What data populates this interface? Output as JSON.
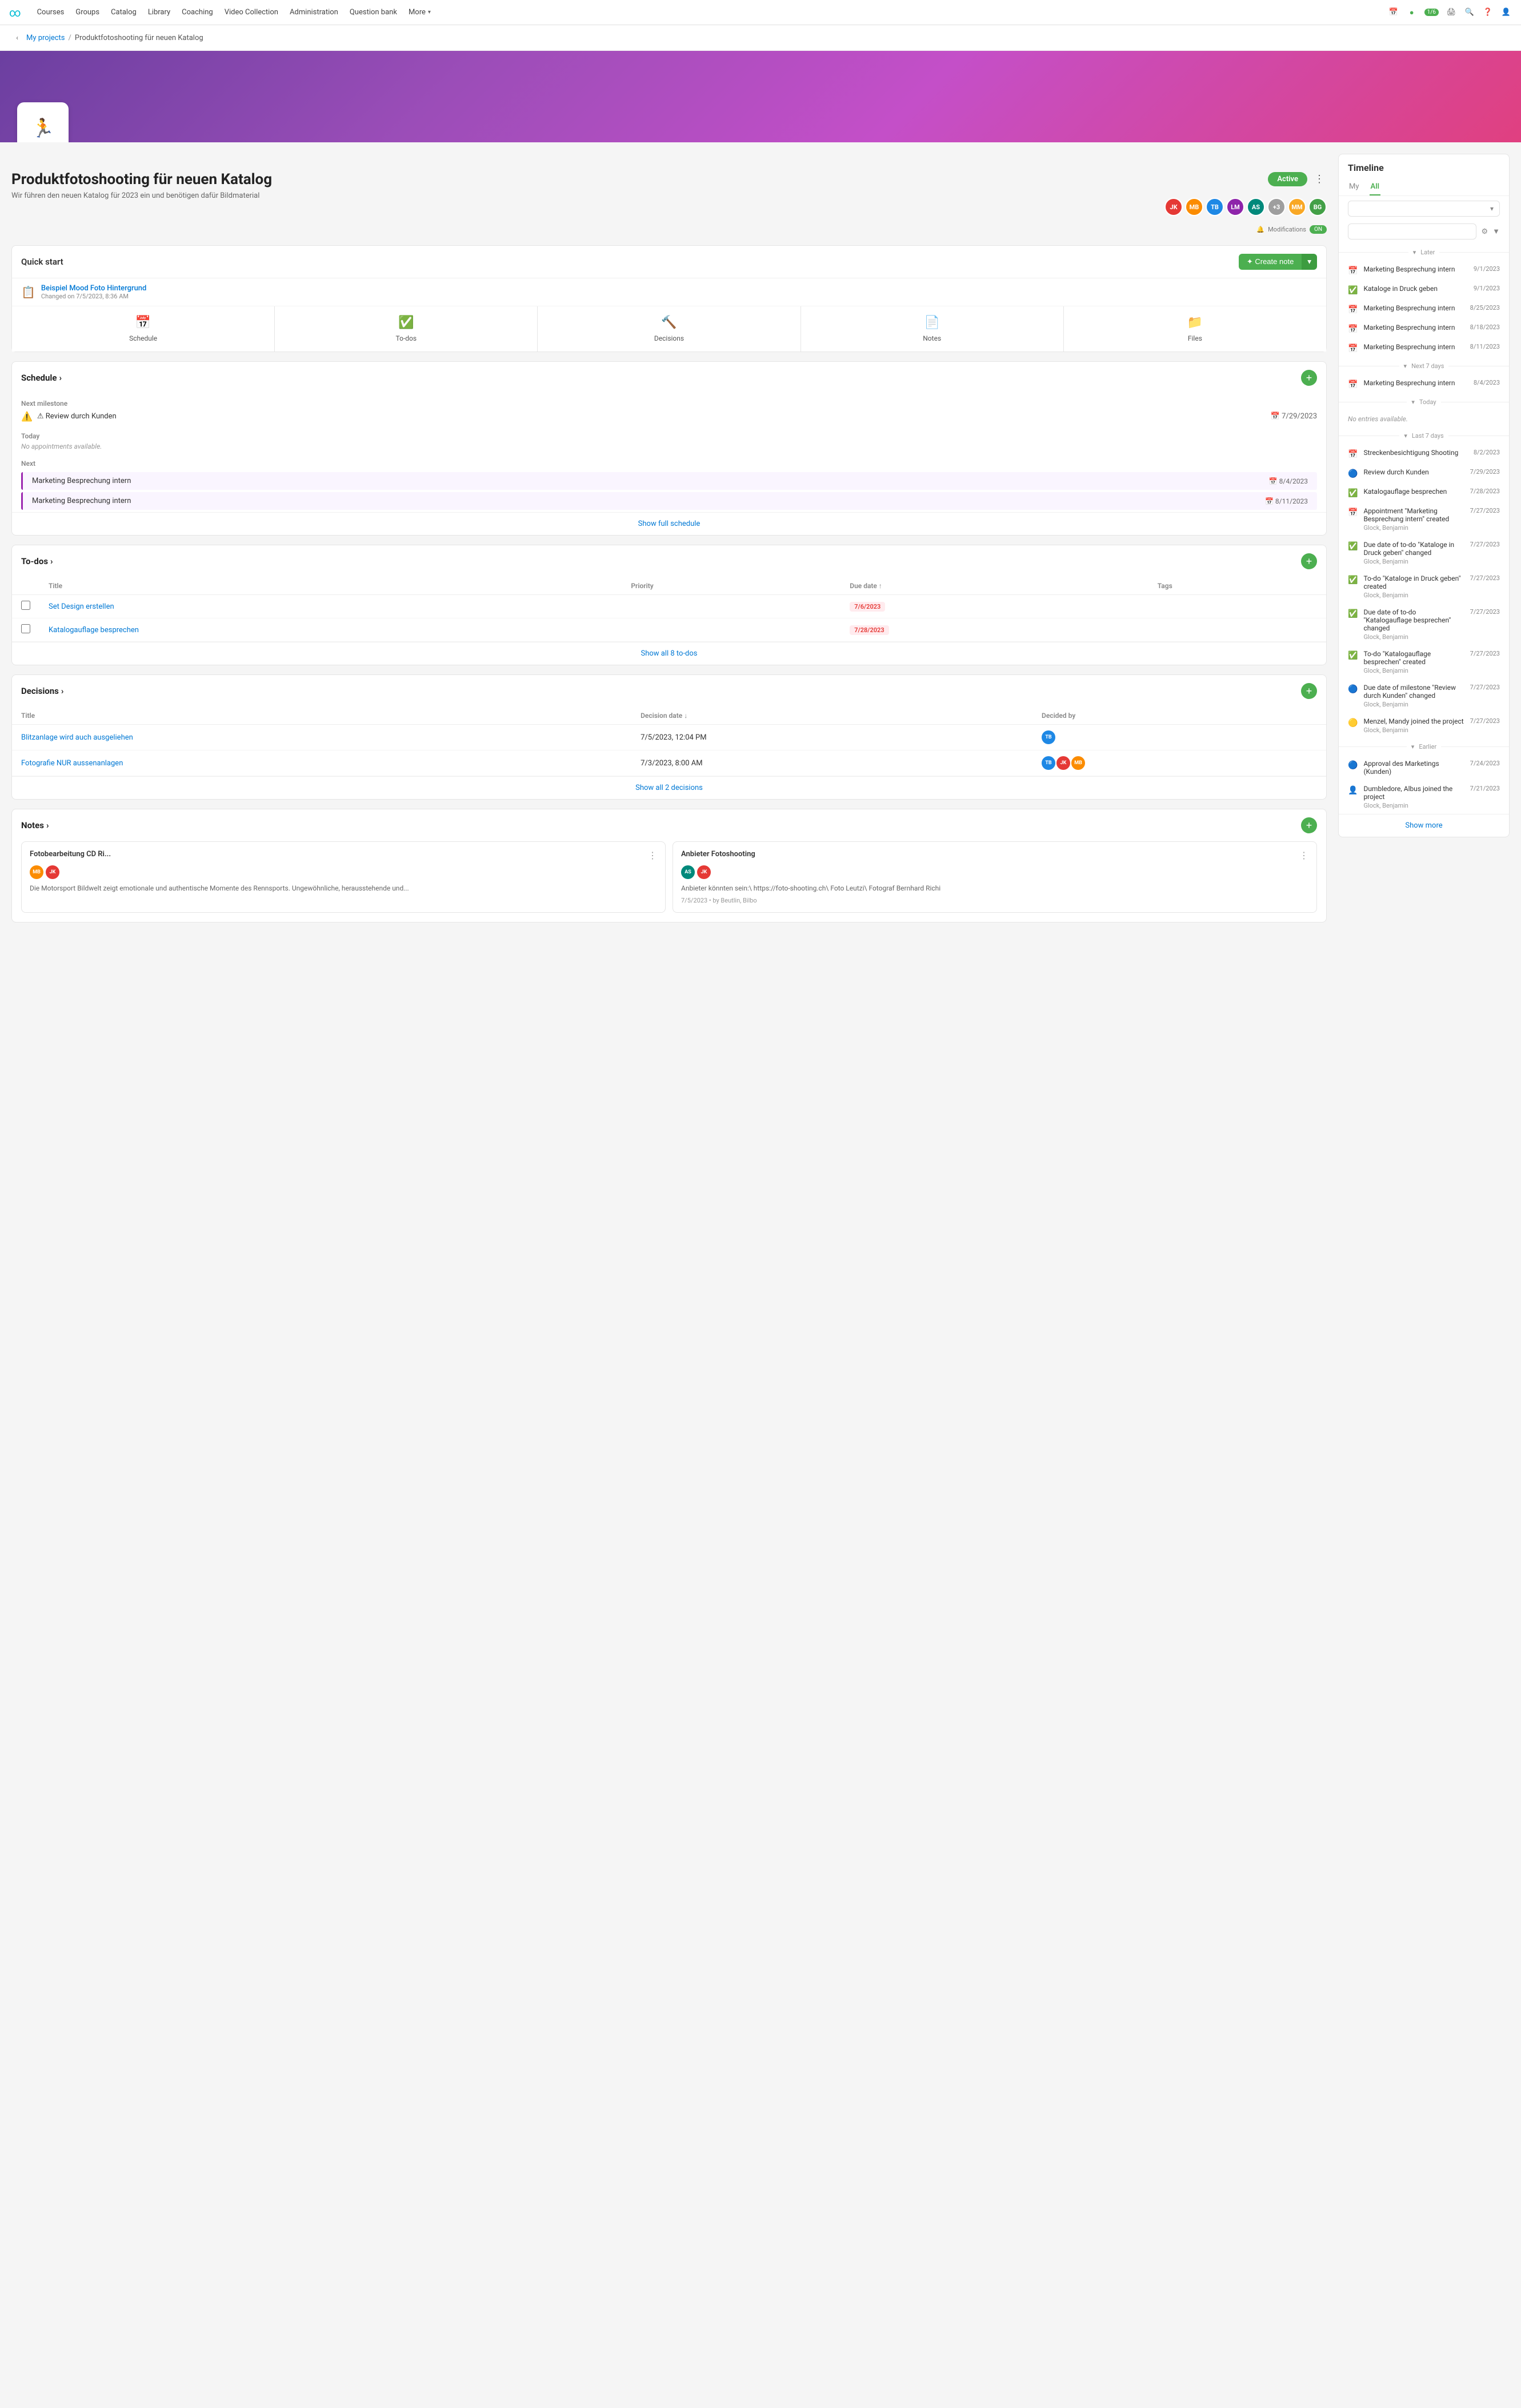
{
  "nav": {
    "logo": "∞",
    "items": [
      "Courses",
      "Groups",
      "Catalog",
      "Library",
      "Coaching",
      "Video Collection",
      "Administration",
      "Question bank",
      "More"
    ],
    "notification": "1/6"
  },
  "breadcrumb": {
    "parent": "My projects",
    "current": "Produktfotoshooting für neuen Katalog"
  },
  "project": {
    "title": "Produktfotoshooting für neuen Katalog",
    "subtitle": "Wir führen den neuen Katalog für 2023 ein und benötigen dafür Bildmaterial",
    "status": "Active",
    "modifications_label": "Modifications",
    "toggle": "ON"
  },
  "quickstart": {
    "title": "Quick start",
    "create_note_label": "✦ Create note",
    "file": {
      "name": "Beispiel Mood Foto Hintergrund",
      "date": "Changed on 7/5/2023, 8:36 AM"
    },
    "nav_items": [
      {
        "label": "Schedule",
        "icon": "📅"
      },
      {
        "label": "To-dos",
        "icon": "✅"
      },
      {
        "label": "Decisions",
        "icon": "🔨"
      },
      {
        "label": "Notes",
        "icon": "📄"
      },
      {
        "label": "Files",
        "icon": "📁"
      }
    ]
  },
  "schedule": {
    "section_title": "Schedule",
    "milestone_label": "Next milestone",
    "milestone_name": "⚠ Review durch Kunden",
    "milestone_date": "7/29/2023",
    "today_label": "Today",
    "no_appt": "No appointments available.",
    "next_label": "Next",
    "items": [
      {
        "name": "Marketing Besprechung intern",
        "date": "📅 8/4/2023"
      },
      {
        "name": "Marketing Besprechung intern",
        "date": "📅 8/11/2023"
      }
    ],
    "show_full": "Show full schedule"
  },
  "todos": {
    "section_title": "To-dos",
    "columns": [
      "Title",
      "Priority",
      "Due date ↑",
      "Tags"
    ],
    "items": [
      {
        "title": "Set Design erstellen",
        "priority": "",
        "due_date": "7/6/2023",
        "tags": ""
      },
      {
        "title": "Katalogauflage besprechen",
        "priority": "",
        "due_date": "7/28/2023",
        "tags": ""
      }
    ],
    "show_all": "Show all 8 to-dos"
  },
  "decisions": {
    "section_title": "Decisions",
    "columns": [
      "Title",
      "Decision date ↓",
      "Decided by"
    ],
    "items": [
      {
        "title": "Blitzanlage wird auch ausgeliehen",
        "date": "7/5/2023, 12:04 PM",
        "decided_by": [
          "av-blue"
        ]
      },
      {
        "title": "Fotografie NUR aussenanlagen",
        "date": "7/3/2023, 8:00 AM",
        "decided_by": [
          "av-blue",
          "av-red",
          "av-orange"
        ]
      }
    ],
    "show_all": "Show all 2 decisions"
  },
  "notes": {
    "section_title": "Notes",
    "items": [
      {
        "title": "Fotobearbeitung CD Ri...",
        "avatars": [
          "av-orange",
          "av-red"
        ],
        "text": "Die Motorsport Bildwelt zeigt emotionale und authentische Momente des Rennsports. Ungewöhnliche, herausstehende und...",
        "date": ""
      },
      {
        "title": "Anbieter Fotoshooting",
        "avatars": [
          "av-teal",
          "av-red"
        ],
        "text": "Anbieter könnten sein:\\ https://foto-shooting.ch\\ Foto Leutzi\\ Fotograf Bernhard Richi",
        "date": "7/5/2023 • by Beutlin, Bilbo"
      }
    ]
  },
  "timeline": {
    "title": "Timeline",
    "tabs": [
      "My",
      "All"
    ],
    "active_tab": "All",
    "sections": {
      "later": {
        "label": "Later",
        "items": [
          {
            "icon": "📅",
            "text": "Marketing Besprechung intern",
            "date": "9/1/2023"
          },
          {
            "icon": "✅",
            "text": "Kataloge in Druck geben",
            "date": "9/1/2023"
          },
          {
            "icon": "📅",
            "text": "Marketing Besprechung intern",
            "date": "8/25/2023"
          },
          {
            "icon": "📅",
            "text": "Marketing Besprechung intern",
            "date": "8/18/2023"
          },
          {
            "icon": "📅",
            "text": "Marketing Besprechung intern",
            "date": "8/11/2023"
          }
        ]
      },
      "next7days": {
        "label": "Next 7 days",
        "items": [
          {
            "icon": "📅",
            "text": "Marketing Besprechung intern",
            "date": "8/4/2023"
          }
        ]
      },
      "today": {
        "label": "Today",
        "no_entries": "No entries available."
      },
      "last7days": {
        "label": "Last 7 days",
        "items": [
          {
            "icon": "📅",
            "text": "Streckenbesichtigung Shooting",
            "date": "8/2/2023",
            "sub": ""
          },
          {
            "icon": "🔵",
            "text": "Review durch Kunden",
            "date": "7/29/2023",
            "sub": ""
          },
          {
            "icon": "✅",
            "text": "Katalogauflage besprechen",
            "date": "7/28/2023",
            "sub": ""
          },
          {
            "icon": "📅",
            "text": "Appointment \"Marketing Besprechung intern\" created",
            "date": "7/27/2023",
            "sub": "Glock, Benjamin"
          },
          {
            "icon": "✅",
            "text": "Due date of to-do \"Kataloge in Druck geben\" changed",
            "date": "7/27/2023",
            "sub": "Glock, Benjamin"
          },
          {
            "icon": "✅",
            "text": "To-do \"Kataloge in Druck geben\" created",
            "date": "7/27/2023",
            "sub": "Glock, Benjamin"
          },
          {
            "icon": "✅",
            "text": "Due date of to-do \"Katalogauflage besprechen\" changed",
            "date": "7/27/2023",
            "sub": "Glock, Benjamin"
          },
          {
            "icon": "✅",
            "text": "To-do \"Katalogauflage besprechen\" created",
            "date": "7/27/2023",
            "sub": "Glock, Benjamin"
          },
          {
            "icon": "🔵",
            "text": "Due date of milestone \"Review durch Kunden\" changed",
            "date": "7/27/2023",
            "sub": "Glock, Benjamin"
          },
          {
            "icon": "🟡",
            "text": "Menzel, Mandy joined the project",
            "date": "7/27/2023",
            "sub": "Glock, Benjamin"
          }
        ]
      },
      "earlier": {
        "label": "Earlier",
        "items": [
          {
            "icon": "🔵",
            "text": "Approval des Marketings (Kunden)",
            "date": "7/24/2023",
            "sub": ""
          },
          {
            "icon": "👤",
            "text": "Dumbledore, Albus joined the project",
            "date": "7/21/2023",
            "sub": "Glock, Benjamin"
          }
        ]
      }
    },
    "show_more": "Show more"
  }
}
